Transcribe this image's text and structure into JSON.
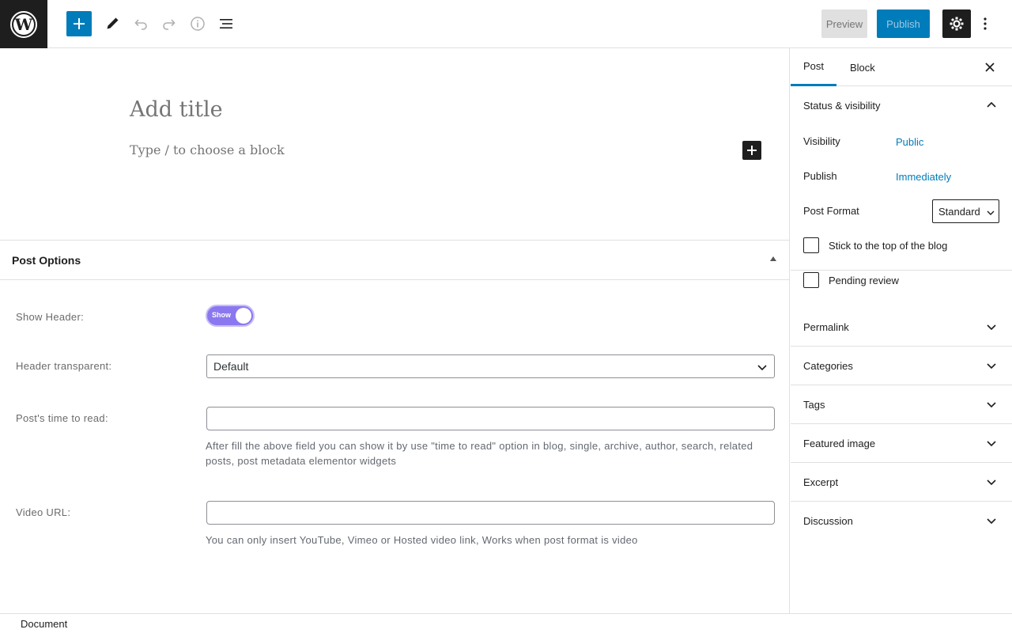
{
  "toolbar": {
    "preview_label": "Preview",
    "publish_label": "Publish"
  },
  "editor": {
    "title_placeholder": "Add title",
    "block_placeholder": "Type / to choose a block"
  },
  "post_options": {
    "title": "Post Options",
    "show_header_label": "Show Header:",
    "show_header_toggle": "Show",
    "header_transparent_label": "Header transparent:",
    "header_transparent_value": "Default",
    "time_to_read_label": "Post's time to read:",
    "time_to_read_value": "",
    "time_to_read_help": "After fill the above field you can show it by use \"time to read\" option in blog, single, archive, author, search, related posts, post metadata elementor widgets",
    "video_url_label": "Video URL:",
    "video_url_value": "",
    "video_url_help": "You can only insert YouTube, Vimeo or Hosted video link, Works when post format is video"
  },
  "sidebar": {
    "tabs": [
      "Post",
      "Block"
    ],
    "status_panel": {
      "title": "Status & visibility",
      "visibility_label": "Visibility",
      "visibility_value": "Public",
      "publish_label": "Publish",
      "publish_value": "Immediately",
      "post_format_label": "Post Format",
      "post_format_value": "Standard",
      "sticky_label": "Stick to the top of the blog",
      "pending_label": "Pending review"
    },
    "panels": [
      "Permalink",
      "Categories",
      "Tags",
      "Featured image",
      "Excerpt",
      "Discussion"
    ]
  },
  "footer": {
    "breadcrumb": "Document"
  },
  "colors": {
    "accent": "#007cba",
    "toggle": "#8b78f0",
    "dark": "#1e1e1e"
  }
}
